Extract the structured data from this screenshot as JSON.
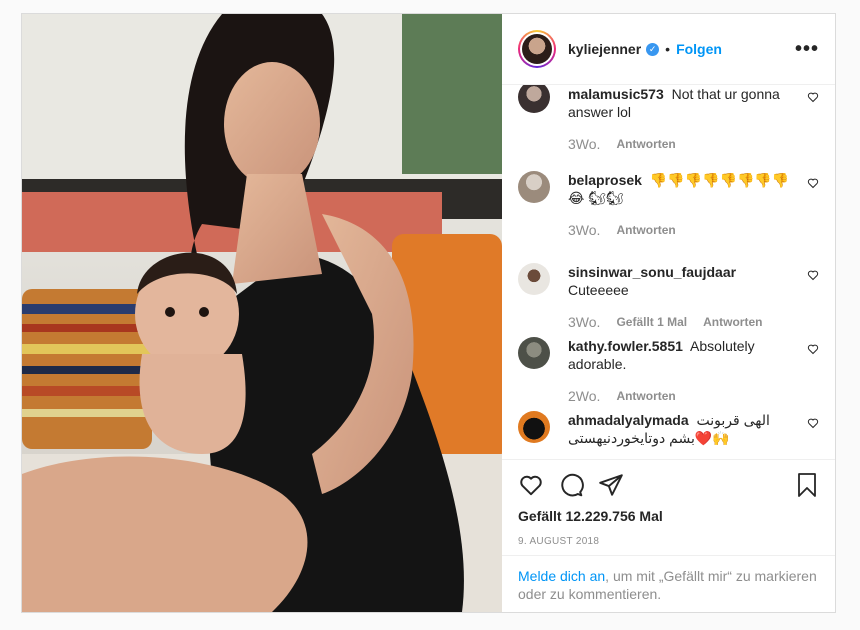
{
  "post": {
    "username": "kyliejenner",
    "follow_label": "Folgen",
    "more_label": "•••",
    "verified_glyph": "✓"
  },
  "comments": [
    {
      "user": "malamusic573",
      "text": "Not that ur gonna answer lol",
      "age": "3Wo.",
      "reply": "Antworten",
      "likes": ""
    },
    {
      "user": "belaprosek",
      "text": "👎👎👎👎👎👎👎👎😂 🐿🐿",
      "age": "3Wo.",
      "reply": "Antworten",
      "likes": ""
    },
    {
      "user": "sinsinwar_sonu_faujdaar",
      "text": "Cuteeeee",
      "age": "3Wo.",
      "reply": "Antworten",
      "likes": "Gefällt 1 Mal"
    },
    {
      "user": "kathy.fowler.5851",
      "text": "Absolutely adorable.",
      "age": "2Wo.",
      "reply": "Antworten",
      "likes": ""
    },
    {
      "user": "ahmadalyalymada",
      "text": "الهی قربونت بشم دوتایخوردنیهستی❤️🙌",
      "age": "",
      "reply": "",
      "likes": ""
    }
  ],
  "actions": {
    "likes_text": "Gefällt 12.229.756 Mal",
    "date_text": "9. August 2018"
  },
  "login": {
    "link_text": "Melde dich an",
    "rest_text": ", um mit „Gefällt mir“ zu markieren oder zu kommentieren."
  },
  "colors": {
    "accent": "#0095f6",
    "muted": "#8e8e8e",
    "border": "#dbdbdb"
  },
  "icons": [
    "heart-icon",
    "comment-icon",
    "share-icon",
    "bookmark-icon",
    "verified-icon",
    "more-icon"
  ]
}
